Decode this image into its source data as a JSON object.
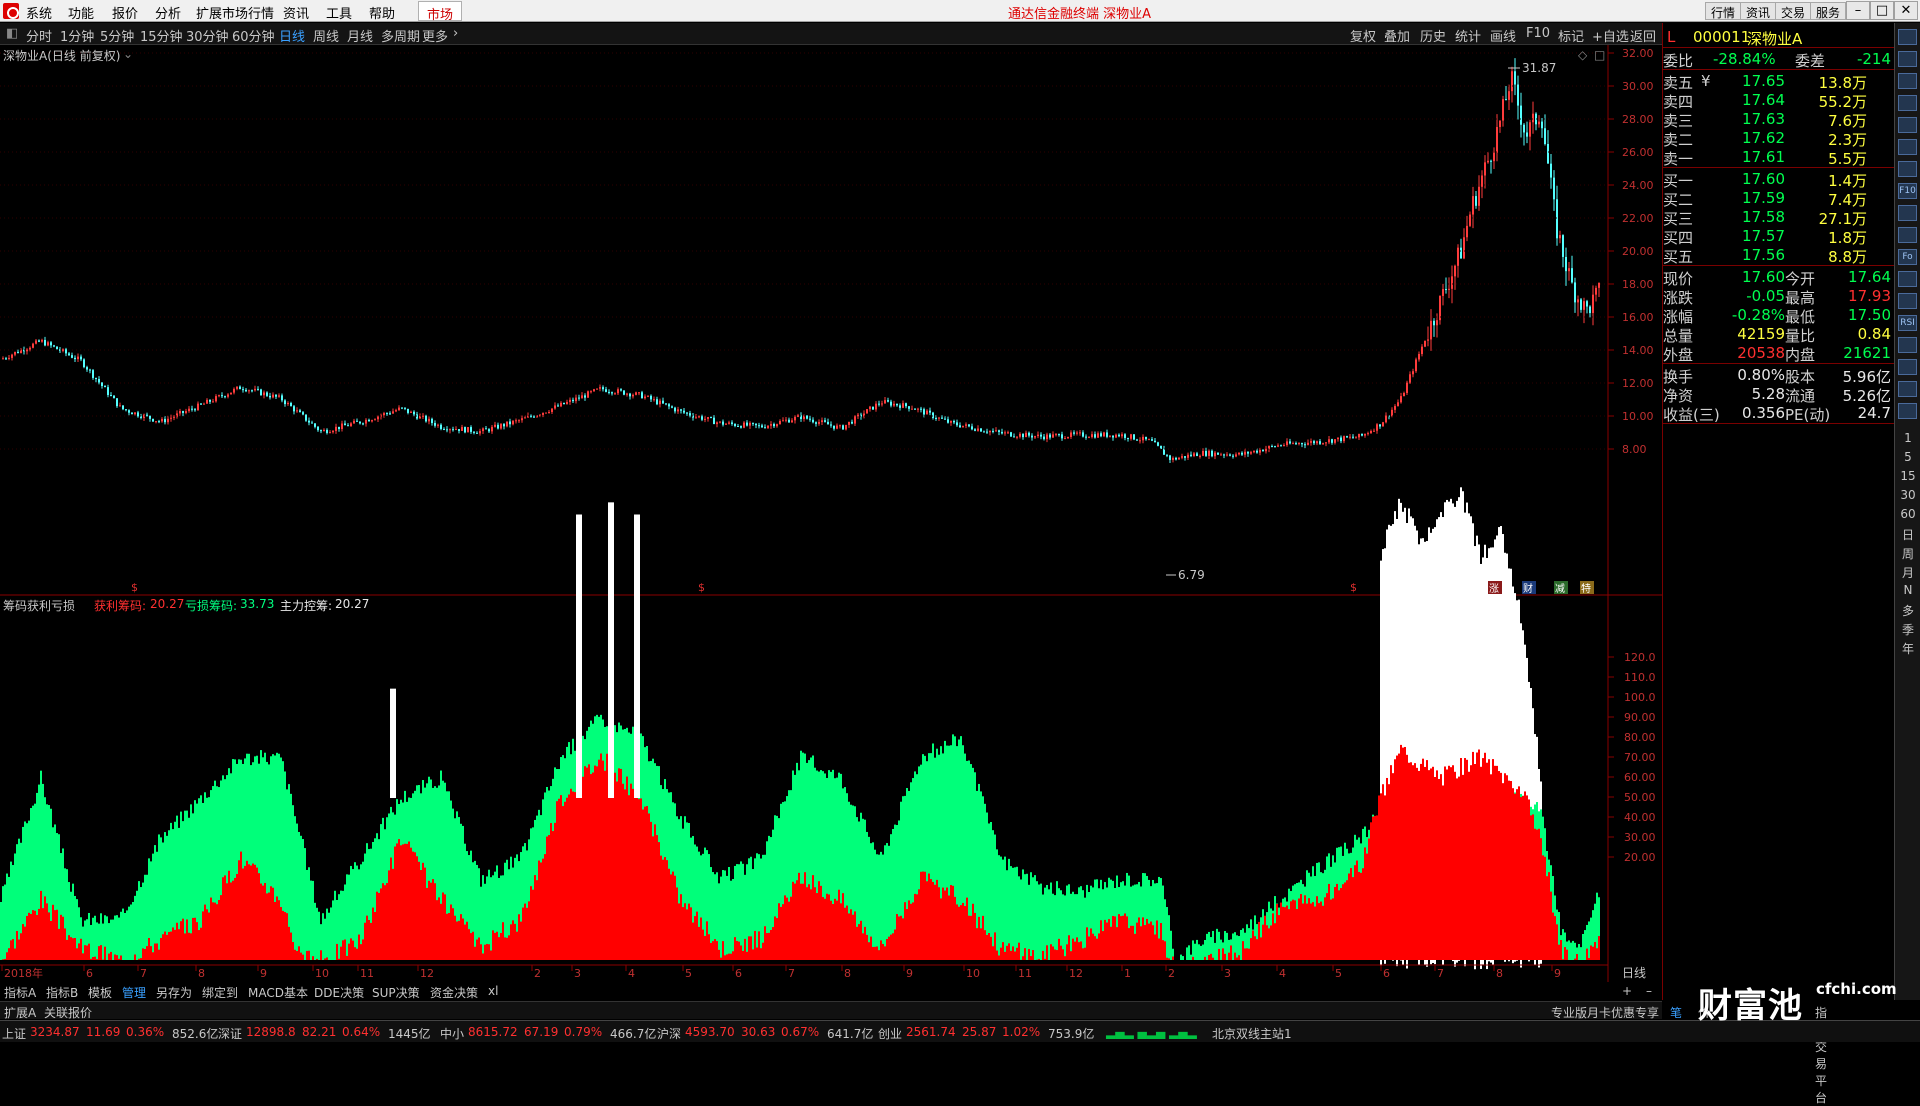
{
  "menubar": {
    "items": [
      "系统",
      "功能",
      "报价",
      "分析",
      "扩展市场行情",
      "资讯",
      "工具",
      "帮助"
    ],
    "market": "市场",
    "app_title": "通达信金融终端  深物业A",
    "right_buttons": [
      "行情",
      "资讯",
      "交易",
      "服务"
    ]
  },
  "toolbar": {
    "periods": [
      "分时",
      "1分钟",
      "5分钟",
      "15分钟",
      "30分钟",
      "60分钟",
      "日线",
      "周线",
      "月线",
      "多周期",
      "更多"
    ],
    "active": "日线",
    "right": [
      "复权",
      "叠加",
      "历史",
      "统计",
      "画线",
      "F10",
      "标记",
      "+自选",
      "返回"
    ]
  },
  "main_chart": {
    "title": "深物业A(日线 前复权)",
    "high_label": "31.87",
    "low_label": "6.79",
    "y_ticks": [
      "32.00",
      "30.00",
      "28.00",
      "26.00",
      "24.00",
      "22.00",
      "20.00",
      "18.00",
      "16.00",
      "14.00",
      "12.00",
      "10.00",
      "8.00"
    ],
    "markers": [
      "涨",
      "财",
      "减",
      "特"
    ]
  },
  "sub_chart": {
    "title": "筹码获利亏损",
    "profit_label": "获利筹码:",
    "profit_value": "20.27",
    "loss_label": "亏损筹码:",
    "loss_value": "33.73",
    "main_label": "主力控筹:",
    "main_value": "20.27",
    "y_ticks": [
      "120.0",
      "110.0",
      "100.0",
      "90.00",
      "80.00",
      "70.00",
      "60.00",
      "50.00",
      "40.00",
      "30.00",
      "20.00"
    ]
  },
  "x_axis": {
    "labels": [
      "2018年",
      "6",
      "7",
      "8",
      "9",
      "10",
      "11",
      "12",
      "2",
      "3",
      "4",
      "5",
      "6",
      "7",
      "8",
      "9",
      "10",
      "11",
      "12",
      "1",
      "2",
      "3",
      "4",
      "5",
      "6",
      "7",
      "8",
      "9"
    ],
    "period": "日线"
  },
  "bottom_tabs": [
    "指标A",
    "指标B",
    "模板",
    "管理",
    "另存为",
    "绑定到",
    "MACD基本",
    "DDE决策",
    "SUP决策",
    "资金决策",
    "xl"
  ],
  "bottom_tabs_active": "管理",
  "bottom_tabs2": [
    "扩展A",
    "关联报价"
  ],
  "quote": {
    "code": "000011",
    "name": "深物业A",
    "flag": "L",
    "weibi_label": "委比",
    "weibi": "-28.84%",
    "weicha_label": "委差",
    "weicha": "-214",
    "asks": [
      {
        "label": "卖五",
        "price": "17.65",
        "vol": "13.8万"
      },
      {
        "label": "卖四",
        "price": "17.64",
        "vol": "55.2万"
      },
      {
        "label": "卖三",
        "price": "17.63",
        "vol": "7.6万"
      },
      {
        "label": "卖二",
        "price": "17.62",
        "vol": "2.3万"
      },
      {
        "label": "卖一",
        "price": "17.61",
        "vol": "5.5万"
      }
    ],
    "ask_mark": "¥",
    "bids": [
      {
        "label": "买一",
        "price": "17.60",
        "vol": "1.4万"
      },
      {
        "label": "买二",
        "price": "17.59",
        "vol": "7.4万"
      },
      {
        "label": "买三",
        "price": "17.58",
        "vol": "27.1万"
      },
      {
        "label": "买四",
        "price": "17.57",
        "vol": "1.8万"
      },
      {
        "label": "买五",
        "price": "17.56",
        "vol": "8.8万"
      }
    ],
    "stats": [
      {
        "l1": "现价",
        "v1": "17.60",
        "l2": "今开",
        "v2": "17.64"
      },
      {
        "l1": "涨跌",
        "v1": "-0.05",
        "l2": "最高",
        "v2": "17.93"
      },
      {
        "l1": "涨幅",
        "v1": "-0.28%",
        "l2": "最低",
        "v2": "17.50"
      },
      {
        "l1": "总量",
        "v1": "42159",
        "l2": "量比",
        "v2": "0.84"
      },
      {
        "l1": "外盘",
        "v1": "20538",
        "l2": "内盘",
        "v2": "21621"
      }
    ],
    "stats2": [
      {
        "l1": "换手",
        "v1": "0.80%",
        "l2": "股本",
        "v2": "5.96亿"
      },
      {
        "l1": "净资",
        "v1": "5.28",
        "l2": "流通",
        "v2": "5.26亿"
      },
      {
        "l1": "收益(三)",
        "v1": "0.356",
        "l2": "PE(动)",
        "v2": "24.7"
      }
    ]
  },
  "status": {
    "indices": [
      {
        "name": "上证",
        "value": "3234.87",
        "chg": "11.69",
        "pct": "0.36%",
        "amt": "852.6亿"
      },
      {
        "name": "深证",
        "value": "12898.8",
        "chg": "82.21",
        "pct": "0.64%",
        "amt": "1445亿"
      },
      {
        "name": "中小",
        "value": "8615.72",
        "chg": "67.19",
        "pct": "0.79%",
        "amt": "466.7亿"
      },
      {
        "name": "沪深",
        "value": "4593.70",
        "chg": "30.63",
        "pct": "0.67%",
        "amt": "641.7亿"
      },
      {
        "name": "创业",
        "value": "2561.74",
        "chg": "25.87",
        "pct": "1.02%",
        "amt": "753.9亿"
      }
    ],
    "server": "北京双线主站1",
    "promo": "专业版月卡优惠专享",
    "promo2": "笔",
    "promo3": "价",
    "promo4": "指标交易平台"
  },
  "side_icons": [
    "market-icon",
    "chart-icon",
    "list-icon",
    "bar-icon",
    "kline-icon",
    "line-icon",
    "grid-icon",
    "f10-icon",
    "table-icon",
    "bars-icon",
    "fund-icon",
    "star-icon",
    "wave-icon",
    "rsi-icon",
    "move-icon",
    "up-icon",
    "down-icon",
    "chip-icon"
  ],
  "side_icon_texts": [
    "",
    "",
    "",
    "",
    "",
    "",
    "",
    "F10",
    "",
    "",
    "Fo",
    "",
    "",
    "RSI",
    "",
    "",
    "",
    ""
  ],
  "side_periods": [
    "1",
    "5",
    "15",
    "30",
    "60",
    "日",
    "周",
    "月",
    "N",
    "多",
    "季",
    "年"
  ],
  "watermark": {
    "logo": "财富池",
    "url": "cfchi.com"
  }
}
